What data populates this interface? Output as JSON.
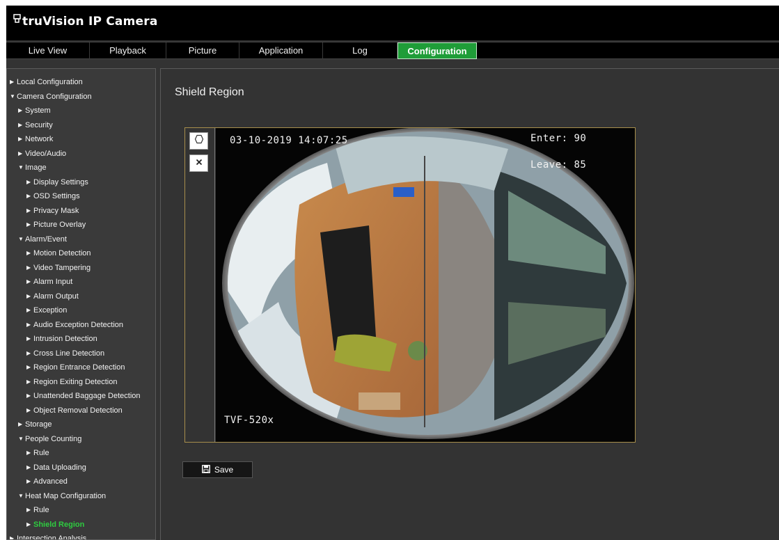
{
  "app": {
    "brand": "truVision IP Camera"
  },
  "nav": {
    "tabs": [
      "Live View",
      "Playback",
      "Picture",
      "Application",
      "Log",
      "Configuration"
    ],
    "active": "Configuration"
  },
  "sidebar": {
    "items": [
      {
        "label": "Local Configuration",
        "expanded": false
      },
      {
        "label": "Camera Configuration",
        "expanded": true
      },
      {
        "label": "System",
        "expanded": false
      },
      {
        "label": "Security",
        "expanded": false
      },
      {
        "label": "Network",
        "expanded": false
      },
      {
        "label": "Video/Audio",
        "expanded": false
      },
      {
        "label": "Image",
        "expanded": true
      },
      {
        "label": "Display Settings",
        "expanded": false
      },
      {
        "label": "OSD Settings",
        "expanded": false
      },
      {
        "label": "Privacy Mask",
        "expanded": false
      },
      {
        "label": "Picture Overlay",
        "expanded": false
      },
      {
        "label": "Alarm/Event",
        "expanded": true
      },
      {
        "label": "Motion Detection",
        "expanded": false
      },
      {
        "label": "Video Tampering",
        "expanded": false
      },
      {
        "label": "Alarm Input",
        "expanded": false
      },
      {
        "label": "Alarm Output",
        "expanded": false
      },
      {
        "label": "Exception",
        "expanded": false
      },
      {
        "label": "Audio Exception Detection",
        "expanded": false
      },
      {
        "label": "Intrusion Detection",
        "expanded": false
      },
      {
        "label": "Cross Line Detection",
        "expanded": false
      },
      {
        "label": "Region Entrance Detection",
        "expanded": false
      },
      {
        "label": "Region Exiting Detection",
        "expanded": false
      },
      {
        "label": "Unattended Baggage Detection",
        "expanded": false
      },
      {
        "label": "Object Removal Detection",
        "expanded": false
      },
      {
        "label": "Storage",
        "expanded": false
      },
      {
        "label": "People Counting",
        "expanded": true
      },
      {
        "label": "Rule",
        "expanded": false
      },
      {
        "label": "Data Uploading",
        "expanded": false
      },
      {
        "label": "Advanced",
        "expanded": false
      },
      {
        "label": "Heat Map Configuration",
        "expanded": true
      },
      {
        "label": "Rule",
        "expanded": false
      },
      {
        "label": "Shield Region",
        "expanded": false,
        "active": true
      },
      {
        "label": "Intersection Analysis",
        "expanded": false
      }
    ]
  },
  "main": {
    "title": "Shield Region",
    "osd": {
      "timestamp": "03-10-2019 14:07:25",
      "enter": "Enter: 90",
      "leave": "Leave: 85",
      "camera_name": "TVF-520x"
    },
    "save_label": "Save"
  },
  "colors": {
    "accent": "#1f9d38",
    "active_text": "#2ecc40",
    "frame_border": "#a88f4c"
  }
}
